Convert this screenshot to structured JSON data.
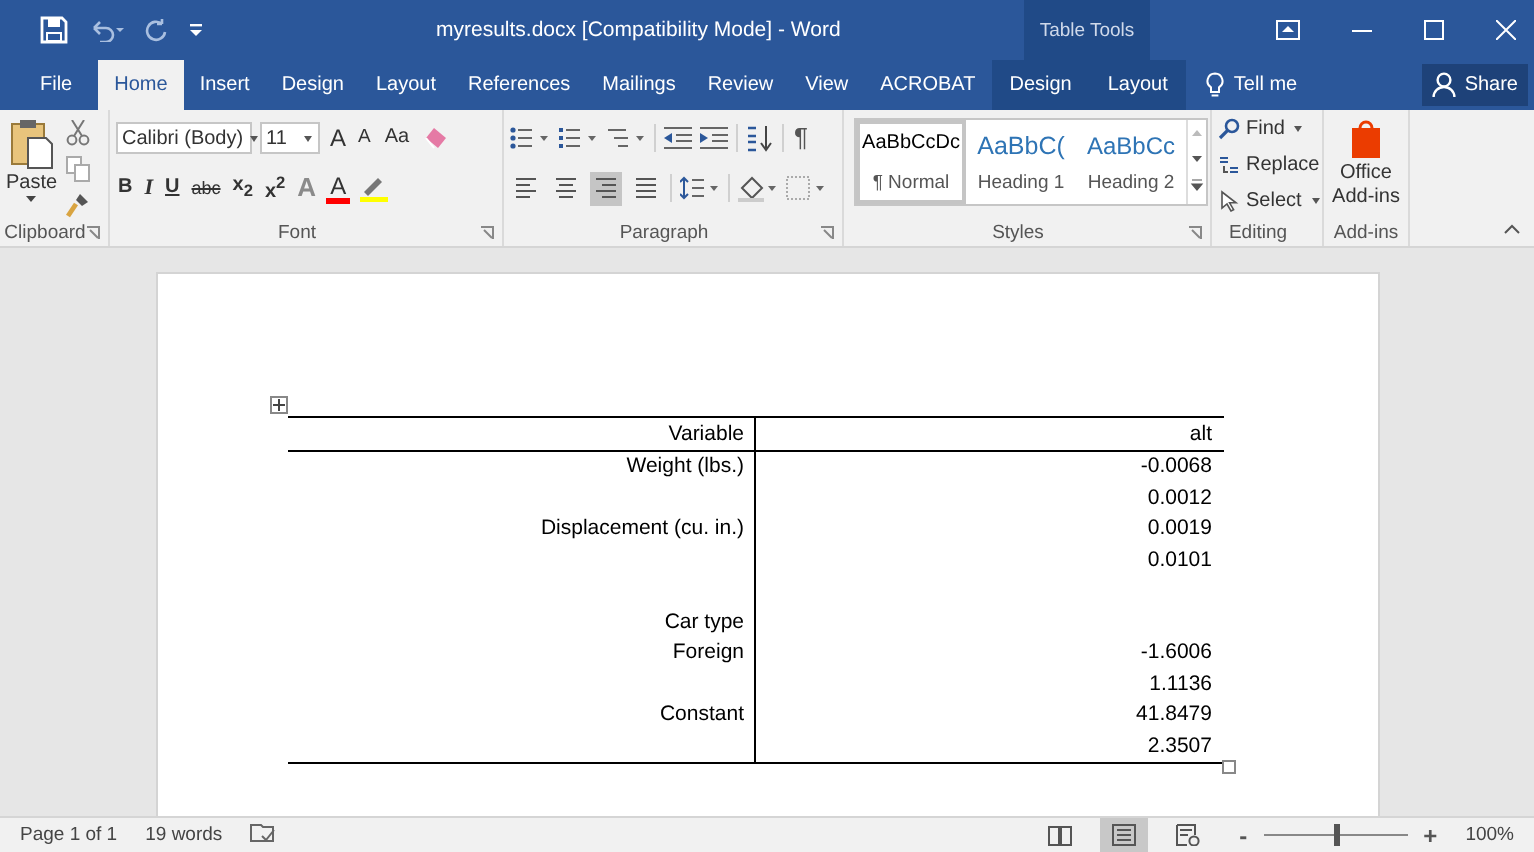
{
  "window": {
    "title": "myresults.docx [Compatibility Mode]  -  Word",
    "context_title": "Table Tools"
  },
  "tabs": [
    {
      "label": "File",
      "kind": "file",
      "selected": false
    },
    {
      "label": "Home",
      "kind": "normal",
      "selected": true
    },
    {
      "label": "Insert",
      "kind": "normal",
      "selected": false
    },
    {
      "label": "Design",
      "kind": "normal",
      "selected": false
    },
    {
      "label": "Layout",
      "kind": "normal",
      "selected": false
    },
    {
      "label": "References",
      "kind": "normal",
      "selected": false
    },
    {
      "label": "Mailings",
      "kind": "normal",
      "selected": false
    },
    {
      "label": "Review",
      "kind": "normal",
      "selected": false
    },
    {
      "label": "View",
      "kind": "normal",
      "selected": false
    },
    {
      "label": "ACROBAT",
      "kind": "normal",
      "selected": false
    },
    {
      "label": "Design",
      "kind": "contextual",
      "selected": false
    },
    {
      "label": "Layout",
      "kind": "contextual",
      "selected": false
    }
  ],
  "tell_me": "Tell me",
  "share": "Share",
  "clipboard": {
    "paste": "Paste",
    "label": "Clipboard"
  },
  "font": {
    "name": "Calibri (Body)",
    "size": "11",
    "label": "Font",
    "row1": [
      {
        "label": "A",
        "kind": "grow"
      },
      {
        "label": "A",
        "kind": "shrink"
      },
      {
        "label": "Aa",
        "kind": "case"
      }
    ],
    "row2": [
      {
        "label": "B",
        "kind": "bold"
      },
      {
        "label": "I",
        "kind": "italic"
      },
      {
        "label": "U",
        "kind": "underline"
      },
      {
        "label": "abc",
        "kind": "strike"
      },
      {
        "label": "x$_{2}$",
        "kind": "script"
      },
      {
        "label": "x$^{2}$",
        "kind": "script"
      },
      {
        "label": "A",
        "kind": "effects"
      },
      {
        "label": "A",
        "kind": "color"
      }
    ]
  },
  "paragraph": {
    "label": "Paragraph",
    "pilcrow": "¶",
    "alignment": [
      {
        "kind": "left",
        "selected": false
      },
      {
        "kind": "center",
        "selected": false
      },
      {
        "kind": "right",
        "selected": true
      },
      {
        "kind": "justify",
        "selected": false
      }
    ]
  },
  "styles": {
    "label": "Styles",
    "items": [
      {
        "preview": "AaBbCcDc",
        "name": "¶ Normal",
        "kind": "body",
        "selected": true
      },
      {
        "preview": "AaBbC(",
        "name": "Heading 1",
        "kind": "heading1",
        "selected": false
      },
      {
        "preview": "AaBbCc",
        "name": "Heading 2",
        "kind": "heading2",
        "selected": false
      }
    ]
  },
  "editing": {
    "label": "Editing",
    "find": "Find",
    "replace": "Replace",
    "select": "Select"
  },
  "addins": {
    "button": "Office Add-ins",
    "label": "Add-ins"
  },
  "table": {
    "columns": [
      "Variable",
      "alt"
    ],
    "rows": [
      {
        "label": "Weight (lbs.)",
        "value": "-0.0068"
      },
      {
        "value": "0.0012"
      },
      {
        "label": "Displacement (cu. in.)",
        "value": "0.0019"
      },
      {
        "value": "0.0101"
      },
      {},
      {
        "label": "Car type"
      },
      {
        "label": "Foreign",
        "value": "-1.6006"
      },
      {
        "value": "1.1136"
      },
      {
        "label": "Constant",
        "value": "41.8479"
      },
      {
        "value": "2.3507"
      }
    ]
  },
  "status_bar": {
    "page": "Page 1 of 1",
    "words": "19 words",
    "views": [
      {
        "kind": "read",
        "selected": false
      },
      {
        "kind": "print",
        "selected": true
      },
      {
        "kind": "web",
        "selected": false
      }
    ],
    "zoom_out": "-",
    "zoom_in": "+",
    "zoom_slider": {
      "level": 0.5
    },
    "zoom": "100%"
  }
}
